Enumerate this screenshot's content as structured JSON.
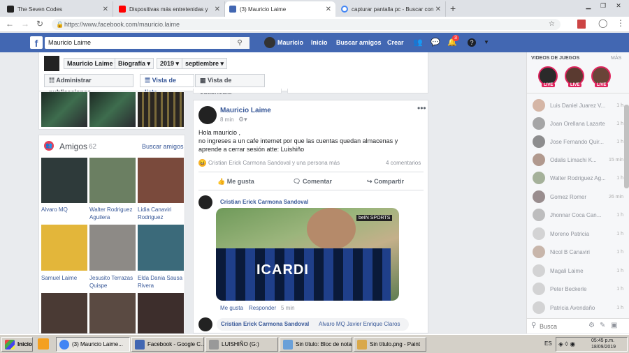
{
  "browser": {
    "tabs": [
      {
        "title": "The Seven Codes",
        "icon": "seven-codes-favicon",
        "color": "#333"
      },
      {
        "title": "Dispositivas más entretenidas y",
        "icon": "youtube-favicon",
        "color": "#ff0000"
      },
      {
        "title": "(3) Mauricio Laime",
        "icon": "facebook-favicon",
        "color": "#4267b2"
      },
      {
        "title": "capturar pantalla pc - Buscar con Go",
        "icon": "google-favicon",
        "color": "#4285f4"
      }
    ],
    "new_tab": "+",
    "url": "https://www.facebook.com/mauricio.laime"
  },
  "fb": {
    "logo": "f",
    "search_value": "Mauricio Laime",
    "profile_name": "Mauricio",
    "nav": [
      "Inicio",
      "Buscar amigos",
      "Crear"
    ],
    "notification_count": "3"
  },
  "profile_header": {
    "name": "Mauricio Laime",
    "section": "Biografía",
    "year": "2019",
    "month": "septiembre",
    "manage_posts": "Administrar publicaciones",
    "list_view": "Vista de lista",
    "grid_view": "Vista de cuadrícula"
  },
  "friends": {
    "title": "Amigos",
    "count": "62",
    "find": "Buscar amigos",
    "items": [
      {
        "name": "Alvaro MQ",
        "color": "#2e3a3a"
      },
      {
        "name": "Walter Rodriguez Aguilera",
        "color": "#6b7f62"
      },
      {
        "name": "Lidia Canaviri Rodriguez",
        "color": "#7a4a3c"
      },
      {
        "name": "Samuel Laime",
        "color": "#e3b63a"
      },
      {
        "name": "Jesusito Terrazas Quispe",
        "color": "#8d8a86"
      },
      {
        "name": "Elda Dania Sausa Rivera",
        "color": "#3b6a7a"
      },
      {
        "name": "",
        "color": "#4a3a34"
      },
      {
        "name": "",
        "color": "#5a4a42"
      },
      {
        "name": "",
        "color": "#3d2e2c"
      }
    ]
  },
  "post": {
    "author": "Mauricio Laime",
    "time": "8 min",
    "text_lines": [
      "Hola mauricio ,",
      "no ingreses a un cafe internet por que las cuentas quedan almacenas y",
      "aprende a cerrar sesión atte: Luishiño"
    ],
    "reactions": "Cristian Erick Carmona Sandoval y una persona más",
    "comments_count": "4 comentarios",
    "actions": [
      "Me gusta",
      "Comentar",
      "Compartir"
    ],
    "comment1": {
      "author": "Cristian Erick Carmona Sandoval",
      "video_badge": "beIN SPORTS",
      "shirt_text": "ICARDI",
      "actions": [
        "Me gusta",
        "Responder",
        "5 min"
      ]
    },
    "comment2": {
      "author": "Cristian Erick Carmona Sandoval",
      "tags": "Alvaro MQ Javier Enrique Claros"
    }
  },
  "chat": {
    "header": "VIDEOS DE JUEGOS",
    "more": "MÁS",
    "live_label": "LIVE",
    "contacts": [
      {
        "name": "Luis Daniel Juarez V...",
        "time": "1 h"
      },
      {
        "name": "Joan Orellana Lazarte",
        "time": "1 h"
      },
      {
        "name": "Jose Fernando Quir...",
        "time": "1 h"
      },
      {
        "name": "Odalis Limachi K...",
        "time": "15 min"
      },
      {
        "name": "Walter Rodriguez Ag...",
        "time": "1 h"
      },
      {
        "name": "Gomez Romer",
        "time": "26 min"
      },
      {
        "name": "Jhonnar Coca Can...",
        "time": "1 h"
      },
      {
        "name": "Moreno Patricia",
        "time": "1 h"
      },
      {
        "name": "Nicol B Canaviri",
        "time": "1 h"
      },
      {
        "name": "Magali Laime",
        "time": "1 h"
      },
      {
        "name": "Peter Beckerle",
        "time": "1 h"
      },
      {
        "name": "Patricia Avendaño",
        "time": "1 h"
      }
    ],
    "search_placeholder": "Busca"
  },
  "taskbar": {
    "start": "Inicio",
    "items": [
      {
        "label": "(3) Mauricio Laime...",
        "active": true,
        "icon": "chrome-icon",
        "color": "#4285f4"
      },
      {
        "label": "Facebook - Google C...",
        "active": false,
        "icon": "facebook-icon",
        "color": "#4267b2"
      },
      {
        "label": "LUISHIÑO (G:)",
        "active": false,
        "icon": "drive-icon",
        "color": "#999"
      },
      {
        "label": "Sin título: Bloc de notas",
        "active": false,
        "icon": "notepad-icon",
        "color": "#6aa0d8"
      },
      {
        "label": "Sin título.png - Paint",
        "active": false,
        "icon": "paint-icon",
        "color": "#d9a84a"
      }
    ],
    "lang": "ES",
    "time": "05:45 p.m.",
    "date": "18/09/2019"
  }
}
